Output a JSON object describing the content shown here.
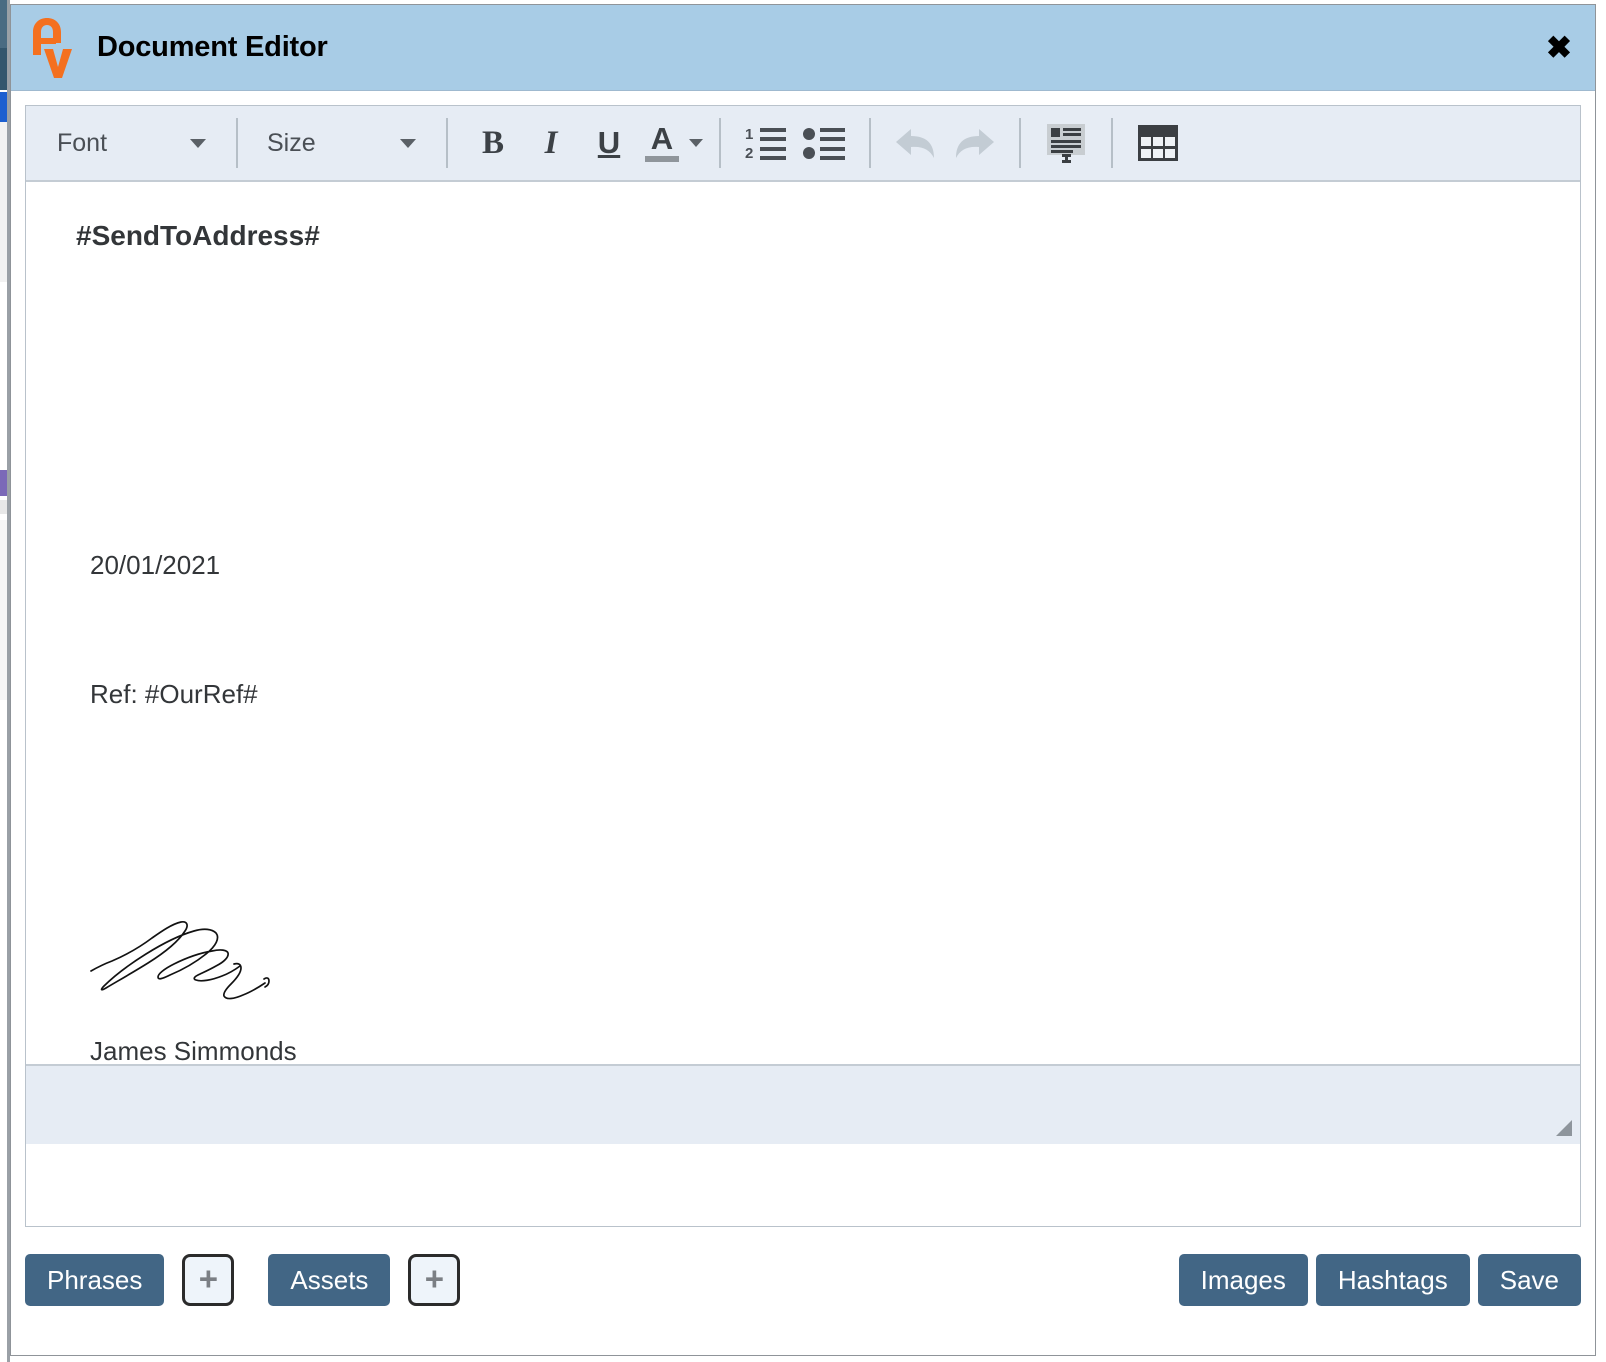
{
  "window": {
    "title": "Document Editor",
    "logo_icon": "av-logo-icon",
    "logo_color": "#f4701f",
    "titlebar_color": "#a8cce6",
    "close_label": "✖",
    "close_icon": "close-icon"
  },
  "toolbar": {
    "font_dropdown": {
      "label": "Font",
      "icon": "chevron-down-icon"
    },
    "size_dropdown": {
      "label": "Size",
      "icon": "chevron-down-icon"
    },
    "bold_label": "B",
    "italic_label": "I",
    "underline_label": "U",
    "text_color_label": "A",
    "text_color_swatch": "#8f959b",
    "buttons": [
      {
        "name": "numbered-list-icon",
        "label": ""
      },
      {
        "name": "bullet-list-icon",
        "label": ""
      },
      {
        "name": "undo-arrow-icon",
        "label": "",
        "disabled": true
      },
      {
        "name": "redo-arrow-icon",
        "label": "",
        "disabled": true
      },
      {
        "name": "insert-template-icon",
        "label": ""
      },
      {
        "name": "insert-table-icon",
        "label": ""
      }
    ]
  },
  "document": {
    "heading": "#SendToAddress#",
    "date": "20/01/2021",
    "reference": "Ref: #OurRef#",
    "signature_icon": "handwritten-signature-image",
    "signature_name": "James Simmonds"
  },
  "statusbar": {
    "resize_grip_icon": "resize-grip-icon"
  },
  "actions": {
    "phrases_label": "Phrases",
    "phrases_add_label": "+",
    "assets_label": "Assets",
    "assets_add_label": "+",
    "images_label": "Images",
    "hashtags_label": "Hashtags",
    "save_label": "Save",
    "button_color": "#426685"
  }
}
